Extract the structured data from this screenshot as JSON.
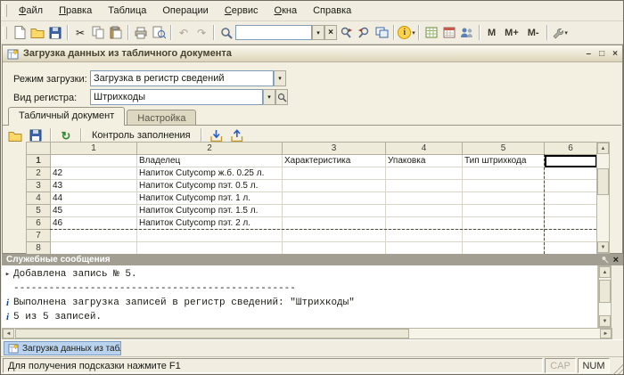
{
  "colors": {
    "selection_border": "#000000",
    "taskbar_active_item": "#b9d3ee",
    "message_title_bar": "#a29f92",
    "window_chrome": "#f1ede0"
  },
  "menu_bar": {
    "items": [
      {
        "label": "Файл"
      },
      {
        "label": "Правка"
      },
      {
        "label": "Таблица"
      },
      {
        "label": "Операции"
      },
      {
        "label": "Сервис"
      },
      {
        "label": "Окна"
      },
      {
        "label": "Справка"
      }
    ]
  },
  "toolbar": {
    "search_value": "",
    "m": "M",
    "m_plus": "M+",
    "m_minus": "M-"
  },
  "window": {
    "title": "Загрузка данных из табличного документа",
    "form": {
      "load_mode_label": "Режим загрузки:",
      "load_mode_value": "Загрузка в регистр сведений",
      "register_kind_label": "Вид регистра:",
      "register_kind_value": "Штрихкоды"
    },
    "tabs": [
      {
        "label": "Табличный документ"
      },
      {
        "label": "Настройка"
      }
    ],
    "tab_toolbar": {
      "fill_check_label": "Контроль заполнения"
    },
    "table": {
      "column_headers": [
        "1",
        "2",
        "3",
        "4",
        "5",
        "6"
      ],
      "rows": [
        {
          "num": "1",
          "cells": [
            "",
            "Владелец",
            "Характеристика",
            "Упаковка",
            "Тип штрихкода",
            ""
          ]
        },
        {
          "num": "2",
          "cells": [
            "42",
            "Напиток Cutycomp ж.б. 0.25 л.",
            "",
            "",
            "",
            ""
          ]
        },
        {
          "num": "3",
          "cells": [
            "43",
            "Напиток Cutycomp пэт. 0.5 л.",
            "",
            "",
            "",
            ""
          ]
        },
        {
          "num": "4",
          "cells": [
            "44",
            "Напиток Cutycomp пэт. 1 л.",
            "",
            "",
            "",
            ""
          ]
        },
        {
          "num": "5",
          "cells": [
            "45",
            "Напиток Cutycomp пэт. 1.5 л.",
            "",
            "",
            "",
            ""
          ]
        },
        {
          "num": "6",
          "cells": [
            "46",
            "Напиток Cutycomp пэт. 2 л.",
            "",
            "",
            "",
            ""
          ]
        },
        {
          "num": "7",
          "cells": [
            "",
            "",
            "",
            "",
            "",
            ""
          ]
        },
        {
          "num": "8",
          "cells": [
            "",
            "",
            "",
            "",
            "",
            ""
          ]
        }
      ]
    }
  },
  "messages_panel": {
    "title": "Служебные сообщения",
    "messages": [
      {
        "bullet": "▸",
        "text": "Добавлена запись № 5."
      },
      {
        "bullet": "",
        "text": "------------------------------------------------"
      },
      {
        "bullet": "i",
        "text": "Выполнена загрузка записей в регистр сведений: \"Штрихкоды\""
      },
      {
        "bullet": "i",
        "text": "5 из 5 записей."
      }
    ]
  },
  "taskbar": {
    "window_button_label": "Загрузка данных из таблич..."
  },
  "status_bar": {
    "hint": "Для получения подсказки нажмите F1",
    "cap_label": "CAP",
    "num_label": "NUM"
  },
  "icons": {
    "dropdown": "▾",
    "clear": "×",
    "cut": "✂",
    "undo": "↶",
    "redo": "↷",
    "refresh": "↻",
    "info_letter": "i",
    "minimize": "–",
    "maximize": "□",
    "close": "×",
    "up": "▲",
    "down": "▼",
    "left": "◄",
    "right": "►"
  }
}
